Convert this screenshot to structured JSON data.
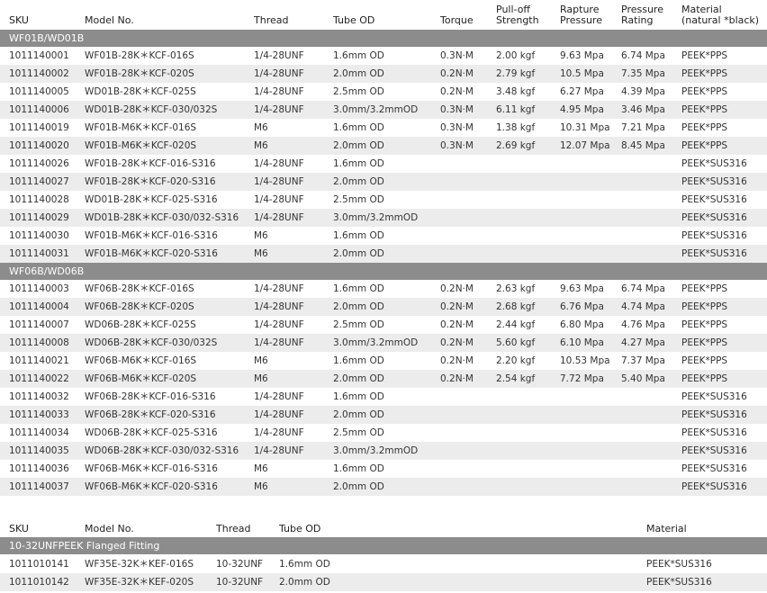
{
  "table1": {
    "headers": {
      "sku": "SKU",
      "model": "Model No.",
      "thread": "Thread",
      "tube_od": "Tube OD",
      "torque": "Torque",
      "pulloff_1": "Pull-off",
      "pulloff_2": "Strength",
      "rapture_1": "Rapture",
      "rapture_2": "Pressure",
      "pressure_1": "Pressure",
      "pressure_2": "Rating",
      "material_1": "Material",
      "material_2": "(natural *black)"
    },
    "groups": [
      {
        "title": "WF01B/WD01B",
        "rows": [
          [
            "1011140001",
            "WF01B-28K＊KCF-016S",
            "1/4-28UNF",
            "1.6mm OD",
            "0.3N·M",
            "2.00 kgf",
            "9.63  Mpa",
            "6.74 Mpa",
            "PEEK*PPS"
          ],
          [
            "1011140002",
            "WF01B-28K＊KCF-020S",
            "1/4-28UNF",
            "2.0mm OD",
            "0.2N·M",
            "2.79 kgf",
            "10.5  Mpa",
            "7.35 Mpa",
            "PEEK*PPS"
          ],
          [
            "1011140005",
            "WD01B-28K＊KCF-025S",
            "1/4-28UNF",
            "2.5mm OD",
            "0.2N·M",
            "3.48 kgf",
            "6.27  Mpa",
            "4.39 Mpa",
            "PEEK*PPS"
          ],
          [
            "1011140006",
            "WD01B-28K＊KCF-030/032S",
            "1/4-28UNF",
            "3.0mm/3.2mmOD",
            "0.3N·M",
            "6.11 kgf",
            "4.95  Mpa",
            "3.46 Mpa",
            "PEEK*PPS"
          ],
          [
            "1011140019",
            "WF01B-M6K＊KCF-016S",
            "M6",
            "1.6mm OD",
            "0.3N·M",
            "1.38 kgf",
            "10.31 Mpa",
            "7.21 Mpa",
            "PEEK*PPS"
          ],
          [
            "1011140020",
            "WF01B-M6K＊KCF-020S",
            "M6",
            "2.0mm OD",
            "0.3N·M",
            "2.69 kgf",
            "12.07 Mpa",
            "8.45 Mpa",
            "PEEK*PPS"
          ],
          [
            "1011140026",
            "WF01B-28K＊KCF-016-S316",
            "1/4-28UNF",
            "1.6mm OD",
            "",
            "",
            "",
            "",
            "PEEK*SUS316"
          ],
          [
            "1011140027",
            "WF01B-28K＊KCF-020-S316",
            "1/4-28UNF",
            "2.0mm OD",
            "",
            "",
            "",
            "",
            "PEEK*SUS316"
          ],
          [
            "1011140028",
            "WD01B-28K＊KCF-025-S316",
            "1/4-28UNF",
            "2.5mm OD",
            "",
            "",
            "",
            "",
            "PEEK*SUS316"
          ],
          [
            "1011140029",
            "WD01B-28K＊KCF-030/032-S316",
            "1/4-28UNF",
            "3.0mm/3.2mmOD",
            "",
            "",
            "",
            "",
            "PEEK*SUS316"
          ],
          [
            "1011140030",
            "WF01B-M6K＊KCF-016-S316",
            "M6",
            "1.6mm OD",
            "",
            "",
            "",
            "",
            "PEEK*SUS316"
          ],
          [
            "1011140031",
            "WF01B-M6K＊KCF-020-S316",
            "M6",
            "2.0mm OD",
            "",
            "",
            "",
            "",
            "PEEK*SUS316"
          ]
        ]
      },
      {
        "title": "WF06B/WD06B",
        "rows": [
          [
            "1011140003",
            "WF06B-28K＊KCF-016S",
            "1/4-28UNF",
            "1.6mm OD",
            "0.2N·M",
            "2.63 kgf",
            "9.63  Mpa",
            "6.74 Mpa",
            "PEEK*PPS"
          ],
          [
            "1011140004",
            "WF06B-28K＊KCF-020S",
            "1/4-28UNF",
            "2.0mm OD",
            "0.2N·M",
            "2.68 kgf",
            "6.76  Mpa",
            "4.74 Mpa",
            "PEEK*PPS"
          ],
          [
            "1011140007",
            "WD06B-28K＊KCF-025S",
            "1/4-28UNF",
            "2.5mm OD",
            "0.2N·M",
            "2.44 kgf",
            "6.80  Mpa",
            "4.76 Mpa",
            "PEEK*PPS"
          ],
          [
            "1011140008",
            "WD06B-28K＊KCF-030/032S",
            "1/4-28UNF",
            "3.0mm/3.2mmOD",
            "0.2N·M",
            "5.60 kgf",
            "6.10  Mpa",
            "4.27 Mpa",
            "PEEK*PPS"
          ],
          [
            "1011140021",
            "WF06B-M6K＊KCF-016S",
            "M6",
            "1.6mm OD",
            "0.2N·M",
            "2.20 kgf",
            "10.53 Mpa",
            "7.37 Mpa",
            "PEEK*PPS"
          ],
          [
            "1011140022",
            "WF06B-M6K＊KCF-020S",
            "M6",
            "2.0mm OD",
            "0.2N·M",
            "2.54 kgf",
            "7.72  Mpa",
            "5.40 Mpa",
            "PEEK*PPS"
          ],
          [
            "1011140032",
            "WF06B-28K＊KCF-016-S316",
            "1/4-28UNF",
            "1.6mm OD",
            "",
            "",
            "",
            "",
            "PEEK*SUS316"
          ],
          [
            "1011140033",
            "WF06B-28K＊KCF-020-S316",
            "1/4-28UNF",
            "2.0mm OD",
            "",
            "",
            "",
            "",
            "PEEK*SUS316"
          ],
          [
            "1011140034",
            "WD06B-28K＊KCF-025-S316",
            "1/4-28UNF",
            "2.5mm OD",
            "",
            "",
            "",
            "",
            "PEEK*SUS316"
          ],
          [
            "1011140035",
            "WD06B-28K＊KCF-030/032-S316",
            "1/4-28UNF",
            "3.0mm/3.2mmOD",
            "",
            "",
            "",
            "",
            "PEEK*SUS316"
          ],
          [
            "1011140036",
            "WF06B-M6K＊KCF-016-S316",
            "M6",
            "1.6mm OD",
            "",
            "",
            "",
            "",
            "PEEK*SUS316"
          ],
          [
            "1011140037",
            "WF06B-M6K＊KCF-020-S316",
            "M6",
            "2.0mm OD",
            "",
            "",
            "",
            "",
            "PEEK*SUS316"
          ]
        ]
      }
    ]
  },
  "table2": {
    "headers": {
      "sku": "SKU",
      "model": "Model No.",
      "thread": "Thread",
      "tube_od": "Tube OD",
      "material": "Material"
    },
    "group_title": "10-32UNFPEEK Flanged Fitting",
    "rows": [
      [
        "1011010141",
        "WF35E-32K＊KEF-016S",
        "10-32UNF",
        "1.6mm OD",
        "PEEK*SUS316"
      ],
      [
        "1011010142",
        "WF35E-32K＊KEF-020S",
        "10-32UNF",
        "2.0mm OD",
        "PEEK*SUS316"
      ]
    ]
  },
  "colors": {
    "group_bar": "#8c8c8c",
    "row_shade": "#ececec",
    "text": "#333333"
  }
}
